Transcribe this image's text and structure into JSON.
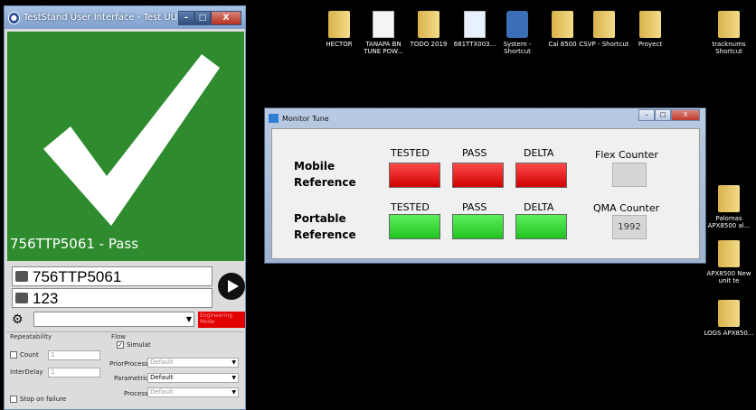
{
  "teststand": {
    "title": "TestStand User Interface - Test UUTs - benchSt...",
    "window_buttons": [
      "–",
      "□",
      "X"
    ],
    "result_text": "756TTP5061 - Pass",
    "result_color": "#2e8b2e",
    "serial_value": "756TTP5061",
    "operator_value": "123",
    "engineering_mode": "Engineering Mode",
    "repeatability": {
      "group_label": "Repeatability",
      "count_label": "Count",
      "count_value": "1",
      "interdelay_label": "InterDelay",
      "interdelay_value": "1",
      "stop_on_failure_label": "Stop on failure"
    },
    "flow": {
      "group_label": "Flow",
      "simulat_label": "Simulat",
      "priorprocess_label": "PriorProcess",
      "priorprocess_value": "Default",
      "parametrics_label": "Parametrics",
      "parametrics_value": "Default",
      "process_label": "Process",
      "process_value": "Default"
    }
  },
  "desktop_icons": [
    {
      "label": "HECTOR",
      "icon": "folder-icon"
    },
    {
      "label": "TANAPA BN TUNE POW...",
      "icon": "document-icon"
    },
    {
      "label": "TODO 2019",
      "icon": "folder-icon"
    },
    {
      "label": "681TTX003...",
      "icon": "spreadsheet-icon"
    },
    {
      "label": "System - Shortcut",
      "icon": "shortcut-icon"
    },
    {
      "label": "Cai 8500",
      "icon": "folder-icon"
    },
    {
      "label": "CSVP - Shortcut",
      "icon": "folder-shortcut-icon"
    },
    {
      "label": "Proyect",
      "icon": "folder-icon"
    },
    {
      "label": "tracknums Shortcut",
      "icon": "folder-shortcut-icon"
    },
    {
      "label": "Palomas APX8500 al...",
      "icon": "folder-icon"
    },
    {
      "label": "APX8500 New unit te",
      "icon": "folder-icon"
    },
    {
      "label": "LOGS APX850...",
      "icon": "folder-icon"
    }
  ],
  "monitor_tune": {
    "title": "Monitor Tune",
    "mobile_label": "Mobile Reference",
    "portable_label": "Portable Reference",
    "tested_label": "TESTED",
    "pass_label": "PASS",
    "delta_label": "DELTA",
    "flex_counter_label": "Flex Counter",
    "flex_counter_value": "",
    "qma_counter_label": "QMA Counter",
    "qma_counter_value": "1992",
    "mobile_status_color": "#e00000",
    "portable_status_color": "#33d633"
  }
}
